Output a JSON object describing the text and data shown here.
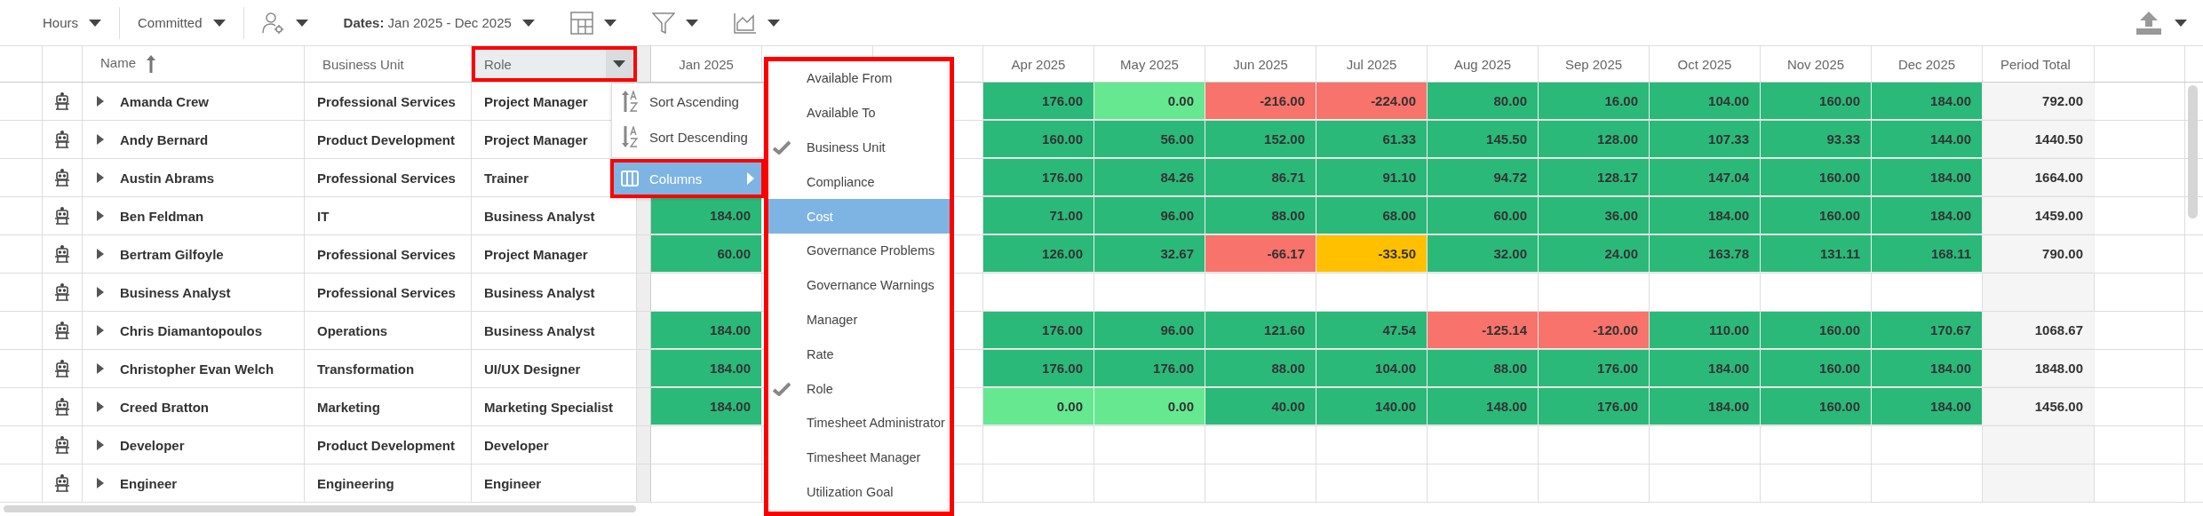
{
  "toolbar": {
    "items": [
      {
        "kind": "dropdown",
        "label": "Hours"
      },
      {
        "kind": "separator"
      },
      {
        "kind": "dropdown",
        "label": "Committed"
      },
      {
        "kind": "separator"
      },
      {
        "kind": "people"
      },
      {
        "kind": "dates",
        "label": "Dates:",
        "value": "Jan 2025 - Dec 2025"
      },
      {
        "kind": "grid"
      },
      {
        "kind": "filter"
      },
      {
        "kind": "chart"
      }
    ]
  },
  "table": {
    "left_columns": [
      {
        "label": "Name",
        "sorted": true,
        "outlined": false
      },
      {
        "label": "Business Unit",
        "sorted": false,
        "outlined": false
      },
      {
        "label": "Role",
        "sorted": false,
        "outlined": true
      }
    ],
    "month_columns": [
      "Jan 2025",
      "Apr 2025",
      "May 2025",
      "Jun 2025",
      "Jul 2025",
      "Aug 2025",
      "Sep 2025",
      "Oct 2025",
      "Nov 2025",
      "Dec 2025"
    ],
    "total_column": "Period Total",
    "rows": [
      {
        "name": "Amanda Crew",
        "business_unit": "Professional Services",
        "role": "Project Manager",
        "months": [
          {
            "value": "176.00",
            "color": "#2bb97a"
          },
          {
            "value": "0.00",
            "color": "#66e891"
          },
          {
            "value": "-216.00",
            "color": "#f8736b"
          },
          {
            "value": "-224.00",
            "color": "#f8736b"
          },
          {
            "value": "80.00",
            "color": "#2bb97a"
          },
          {
            "value": "16.00",
            "color": "#2bb97a"
          },
          {
            "value": "104.00",
            "color": "#2bb97a"
          },
          {
            "value": "160.00",
            "color": "#2bb97a"
          },
          {
            "value": "184.00",
            "color": "#2bb97a"
          }
        ],
        "total": "792.00"
      },
      {
        "name": "Andy Bernard",
        "business_unit": "Product Development",
        "role": "Project Manager",
        "months": [
          {
            "value": "160.00",
            "color": "#2bb97a"
          },
          {
            "value": "56.00",
            "color": "#2bb97a"
          },
          {
            "value": "152.00",
            "color": "#2bb97a"
          },
          {
            "value": "61.33",
            "color": "#2bb97a"
          },
          {
            "value": "145.50",
            "color": "#2bb97a"
          },
          {
            "value": "128.00",
            "color": "#2bb97a"
          },
          {
            "value": "107.33",
            "color": "#2bb97a"
          },
          {
            "value": "93.33",
            "color": "#2bb97a"
          },
          {
            "value": "144.00",
            "color": "#2bb97a"
          }
        ],
        "total": "1440.50"
      },
      {
        "name": "Austin Abrams",
        "business_unit": "Professional Services",
        "role": "Trainer",
        "months": [
          {
            "value": "176.00",
            "color": "#2bb97a"
          },
          {
            "value": "84.26",
            "color": "#2bb97a"
          },
          {
            "value": "86.71",
            "color": "#2bb97a"
          },
          {
            "value": "91.10",
            "color": "#2bb97a"
          },
          {
            "value": "94.72",
            "color": "#2bb97a"
          },
          {
            "value": "128.17",
            "color": "#2bb97a"
          },
          {
            "value": "147.04",
            "color": "#2bb97a"
          },
          {
            "value": "160.00",
            "color": "#2bb97a"
          },
          {
            "value": "184.00",
            "color": "#2bb97a"
          }
        ],
        "total": "1664.00"
      },
      {
        "name": "Ben Feldman",
        "business_unit": "IT",
        "role": "Business Analyst",
        "jan": {
          "value": "184.00",
          "color": "#2bb97a"
        },
        "months": [
          {
            "value": "71.00",
            "color": "#2bb97a"
          },
          {
            "value": "96.00",
            "color": "#2bb97a"
          },
          {
            "value": "88.00",
            "color": "#2bb97a"
          },
          {
            "value": "68.00",
            "color": "#2bb97a"
          },
          {
            "value": "60.00",
            "color": "#2bb97a"
          },
          {
            "value": "36.00",
            "color": "#2bb97a"
          },
          {
            "value": "184.00",
            "color": "#2bb97a"
          },
          {
            "value": "160.00",
            "color": "#2bb97a"
          },
          {
            "value": "184.00",
            "color": "#2bb97a"
          }
        ],
        "total": "1459.00"
      },
      {
        "name": "Bertram Gilfoyle",
        "business_unit": "Professional Services",
        "role": "Project Manager",
        "jan": {
          "value": "60.00",
          "color": "#2bb97a"
        },
        "months": [
          {
            "value": "126.00",
            "color": "#2bb97a"
          },
          {
            "value": "32.67",
            "color": "#2bb97a"
          },
          {
            "value": "-66.17",
            "color": "#f8736b"
          },
          {
            "value": "-33.50",
            "color": "#ffc000"
          },
          {
            "value": "32.00",
            "color": "#2bb97a"
          },
          {
            "value": "24.00",
            "color": "#2bb97a"
          },
          {
            "value": "163.78",
            "color": "#2bb97a"
          },
          {
            "value": "131.11",
            "color": "#2bb97a"
          },
          {
            "value": "168.11",
            "color": "#2bb97a"
          }
        ],
        "total": "790.00"
      },
      {
        "name": "Business Analyst",
        "business_unit": "Professional Services",
        "role": "Business Analyst"
      },
      {
        "name": "Chris Diamantopoulos",
        "business_unit": "Operations",
        "role": "Business Analyst",
        "jan": {
          "value": "184.00",
          "color": "#2bb97a"
        },
        "months": [
          {
            "value": "176.00",
            "color": "#2bb97a"
          },
          {
            "value": "96.00",
            "color": "#2bb97a"
          },
          {
            "value": "121.60",
            "color": "#2bb97a"
          },
          {
            "value": "47.54",
            "color": "#2bb97a"
          },
          {
            "value": "-125.14",
            "color": "#f8736b"
          },
          {
            "value": "-120.00",
            "color": "#f8736b"
          },
          {
            "value": "110.00",
            "color": "#2bb97a"
          },
          {
            "value": "160.00",
            "color": "#2bb97a"
          },
          {
            "value": "170.67",
            "color": "#2bb97a"
          }
        ],
        "total": "1068.67"
      },
      {
        "name": "Christopher Evan Welch",
        "business_unit": "Transformation",
        "role": "UI/UX Designer",
        "jan": {
          "value": "184.00",
          "color": "#2bb97a"
        },
        "months": [
          {
            "value": "176.00",
            "color": "#2bb97a"
          },
          {
            "value": "176.00",
            "color": "#2bb97a"
          },
          {
            "value": "88.00",
            "color": "#2bb97a"
          },
          {
            "value": "104.00",
            "color": "#2bb97a"
          },
          {
            "value": "88.00",
            "color": "#2bb97a"
          },
          {
            "value": "176.00",
            "color": "#2bb97a"
          },
          {
            "value": "184.00",
            "color": "#2bb97a"
          },
          {
            "value": "160.00",
            "color": "#2bb97a"
          },
          {
            "value": "184.00",
            "color": "#2bb97a"
          }
        ],
        "total": "1848.00"
      },
      {
        "name": "Creed Bratton",
        "business_unit": "Marketing",
        "role": "Marketing Specialist",
        "jan": {
          "value": "184.00",
          "color": "#2bb97a"
        },
        "months": [
          {
            "value": "0.00",
            "color": "#66e891"
          },
          {
            "value": "0.00",
            "color": "#66e891"
          },
          {
            "value": "40.00",
            "color": "#2bb97a"
          },
          {
            "value": "140.00",
            "color": "#2bb97a"
          },
          {
            "value": "148.00",
            "color": "#2bb97a"
          },
          {
            "value": "176.00",
            "color": "#2bb97a"
          },
          {
            "value": "184.00",
            "color": "#2bb97a"
          },
          {
            "value": "160.00",
            "color": "#2bb97a"
          },
          {
            "value": "184.00",
            "color": "#2bb97a"
          }
        ],
        "total": "1456.00"
      },
      {
        "name": "Developer",
        "business_unit": "Product Development",
        "role": "Developer"
      },
      {
        "name": "Engineer",
        "business_unit": "Engineering",
        "role": "Engineer"
      }
    ]
  },
  "column_menu": {
    "items": [
      {
        "kind": "sort-asc",
        "label": "Sort Ascending",
        "selected": false,
        "outlined": false
      },
      {
        "kind": "sort-desc",
        "label": "Sort Descending",
        "selected": false,
        "outlined": false
      },
      {
        "kind": "columns",
        "label": "Columns",
        "selected": true,
        "outlined": true
      }
    ]
  },
  "columns_submenu": {
    "outlined": true,
    "items": [
      {
        "label": "Available From",
        "checked": false,
        "selected": false
      },
      {
        "label": "Available To",
        "checked": false,
        "selected": false
      },
      {
        "label": "Business Unit",
        "checked": true,
        "selected": false
      },
      {
        "label": "Compliance",
        "checked": false,
        "selected": false
      },
      {
        "label": "Cost",
        "checked": false,
        "selected": true
      },
      {
        "label": "Governance Problems",
        "checked": false,
        "selected": false
      },
      {
        "label": "Governance Warnings",
        "checked": false,
        "selected": false
      },
      {
        "label": "Manager",
        "checked": false,
        "selected": false
      },
      {
        "label": "Rate",
        "checked": false,
        "selected": false
      },
      {
        "label": "Role",
        "checked": true,
        "selected": false
      },
      {
        "label": "Timesheet Administrator",
        "checked": false,
        "selected": false
      },
      {
        "label": "Timesheet Manager",
        "checked": false,
        "selected": false
      },
      {
        "label": "Utilization Goal",
        "checked": false,
        "selected": false
      }
    ]
  }
}
